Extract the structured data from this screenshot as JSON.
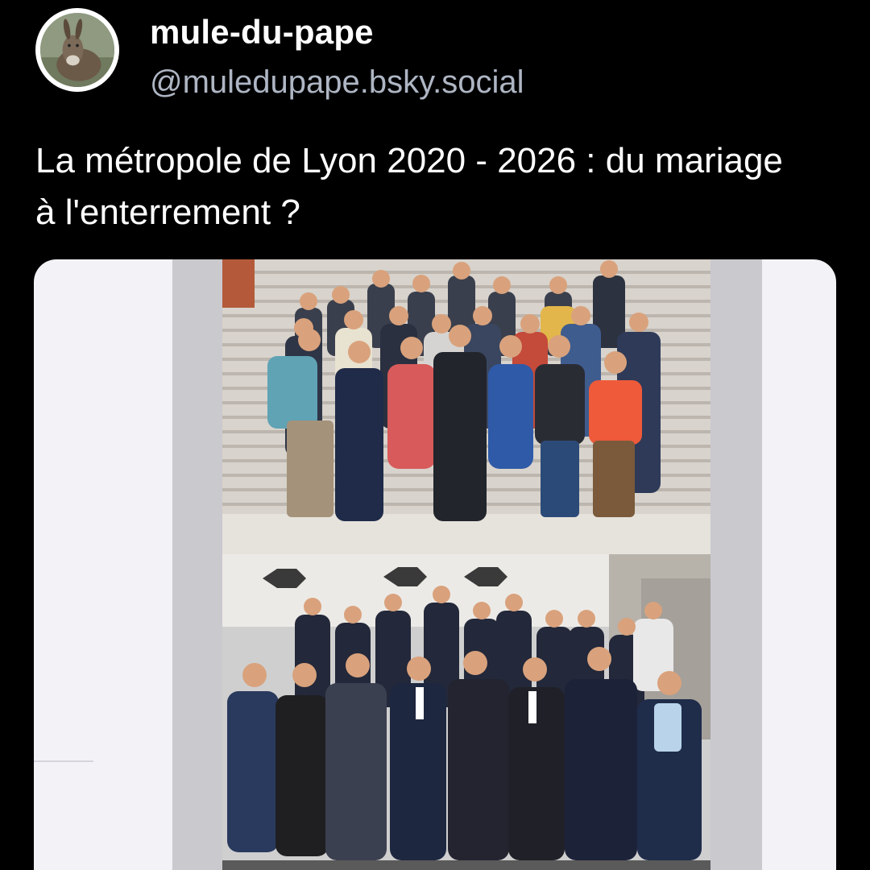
{
  "author": {
    "display_name": "mule-du-pape",
    "handle": "@muledupape.bsky.social"
  },
  "post": {
    "text": "La métropole de Lyon 2020 - 2026 : du mariage à l'enterrement ?"
  },
  "colors": {
    "background": "#000000",
    "handle": "#aeb6c4",
    "embed_background": "#f3f3f7"
  },
  "icons": {
    "avatar": "donkey-avatar"
  }
}
